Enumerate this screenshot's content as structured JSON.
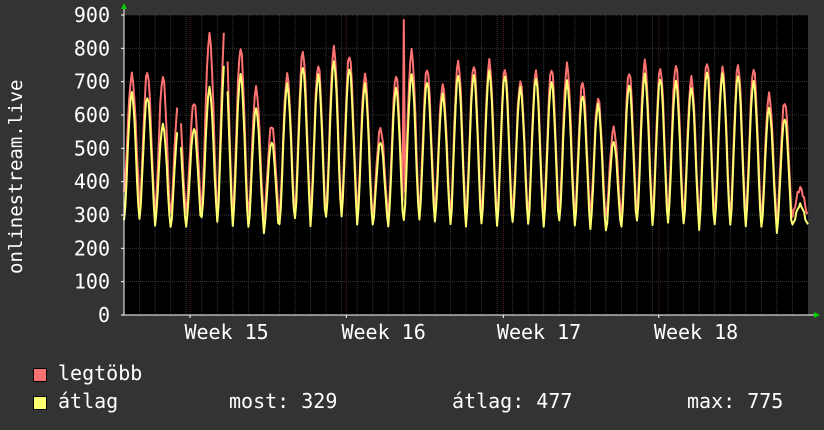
{
  "colors": {
    "background": "#333333",
    "plot_background": "#000000",
    "grid_minor": "#3a3a3a",
    "grid_major": "#5a2222",
    "axis": "#ffffff",
    "arrow": "#00cc00",
    "series_max": "#ff7272",
    "series_avg": "#ffff72"
  },
  "legend": [
    {
      "label": "legtöbb",
      "color": "#ff7272"
    },
    {
      "label": "átlag",
      "color": "#ffff72"
    }
  ],
  "stats": {
    "now": "most: 329",
    "avg": "átlag: 477",
    "max": "max: 775"
  },
  "chart_data": {
    "type": "line",
    "ylabel": "onlinestream.live",
    "ylim": [
      0,
      900
    ],
    "yticks": [
      0,
      100,
      200,
      300,
      400,
      500,
      600,
      700,
      800,
      900
    ],
    "xlabels": [
      "Week 15",
      "Week 16",
      "Week 17",
      "Week 18"
    ],
    "days": 44,
    "samples_per_day": 12,
    "x_week_label_days": [
      6.6,
      16.7,
      26.7,
      36.8
    ],
    "major_grid_days": [
      4.25,
      14.3,
      24.4,
      34.4
    ],
    "day_grid_count": 44,
    "gaps_days": [
      [
        3.5,
        3.65
      ],
      [
        6.5,
        6.6
      ]
    ],
    "spikes": [
      {
        "day": 18.0,
        "value": 885
      }
    ],
    "series": [
      {
        "name": "legtöbb",
        "color": "#ff7272",
        "daily_max": [
          720,
          730,
          715,
          640,
          640,
          840,
          870,
          800,
          680,
          570,
          720,
          790,
          750,
          800,
          780,
          720,
          560,
          720,
          790,
          740,
          690,
          760,
          750,
          760,
          740,
          700,
          730,
          740,
          750,
          700,
          650,
          560,
          730,
          760,
          740,
          750,
          710,
          760,
          740,
          750,
          740,
          660,
          640,
          380
        ],
        "daily_min": [
          370,
          310,
          300,
          300,
          310,
          320,
          300,
          300,
          300,
          290,
          300,
          320,
          300,
          320,
          330,
          300,
          300,
          300,
          310,
          320,
          310,
          300,
          300,
          300,
          300,
          310,
          300,
          300,
          310,
          300,
          300,
          290,
          300,
          310,
          300,
          310,
          300,
          290,
          300,
          300,
          300,
          290,
          280,
          300
        ]
      },
      {
        "name": "átlag",
        "color": "#ffff72",
        "daily_max": [
          665,
          655,
          570,
          560,
          560,
          680,
          770,
          720,
          620,
          520,
          690,
          745,
          720,
          760,
          740,
          690,
          520,
          680,
          720,
          700,
          660,
          720,
          720,
          730,
          720,
          680,
          710,
          700,
          700,
          660,
          630,
          520,
          690,
          720,
          710,
          700,
          680,
          730,
          720,
          720,
          700,
          620,
          590,
          330
        ],
        "daily_min": [
          280,
          290,
          270,
          260,
          270,
          290,
          280,
          270,
          260,
          250,
          270,
          290,
          270,
          290,
          300,
          270,
          270,
          270,
          280,
          290,
          280,
          270,
          270,
          270,
          270,
          280,
          270,
          270,
          280,
          270,
          260,
          250,
          270,
          280,
          270,
          280,
          270,
          260,
          270,
          270,
          270,
          260,
          250,
          270
        ]
      }
    ]
  }
}
